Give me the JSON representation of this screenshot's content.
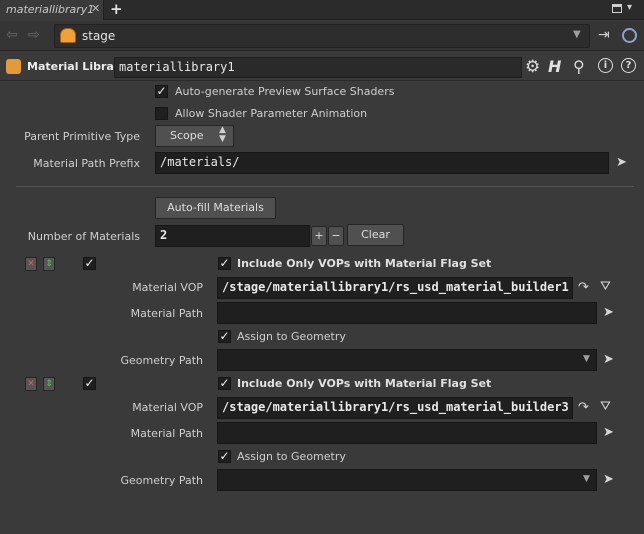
{
  "tab": {
    "title": "materiallibrary1",
    "close": "✕",
    "add": "+"
  },
  "pathbar": {
    "path": "stage"
  },
  "node": {
    "type_label": "Material Library",
    "name": "materiallibrary1"
  },
  "params": {
    "auto_generate_label": "Auto-generate Preview Surface Shaders",
    "allow_anim_label": "Allow Shader Parameter Animation",
    "parent_prim_type_label": "Parent Primitive Type",
    "parent_prim_type_value": "Scope",
    "material_path_prefix_label": "Material Path Prefix",
    "material_path_prefix_value": "/materials/",
    "autofill_button": "Auto-fill Materials",
    "num_materials_label": "Number of Materials",
    "num_materials_value": "2",
    "clear_button": "Clear",
    "plus": "+",
    "minus": "−"
  },
  "materials": [
    {
      "include_only_label": "Include Only VOPs with Material Flag Set",
      "material_vop_label": "Material VOP",
      "material_vop_value": "/stage/materiallibrary1/rs_usd_material_builder1",
      "material_path_label": "Material Path",
      "material_path_value": "",
      "assign_label": "Assign to Geometry",
      "geometry_path_label": "Geometry Path",
      "geometry_path_value": ""
    },
    {
      "include_only_label": "Include Only VOPs with Material Flag Set",
      "material_vop_label": "Material VOP",
      "material_vop_value": "/stage/materiallibrary1/rs_usd_material_builder3",
      "material_path_label": "Material Path",
      "material_path_value": "",
      "assign_label": "Assign to Geometry",
      "geometry_path_label": "Geometry Path",
      "geometry_path_value": ""
    }
  ],
  "colors": {
    "background": "#3a3a3a",
    "field": "#1f1f1f",
    "accent": "#e39a3a"
  }
}
